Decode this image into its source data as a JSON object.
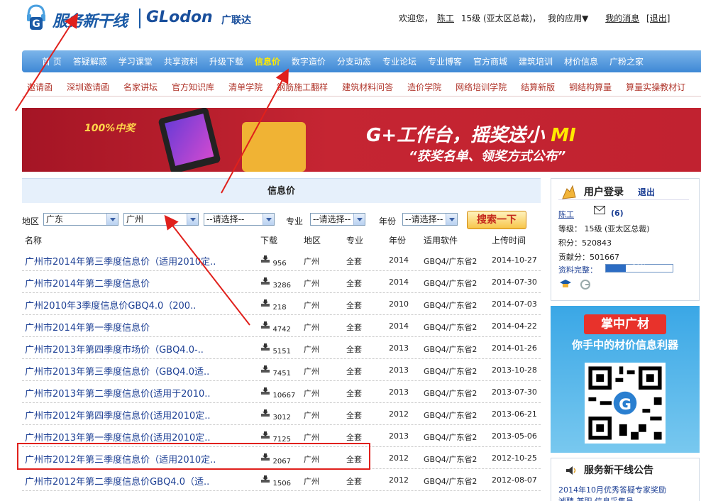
{
  "header": {
    "logo_text": "服务新干线",
    "brand": "GLodon",
    "brand_cn": "广联达",
    "welcome": "欢迎您，",
    "user": "陈工",
    "level": "15级 (亚太区总裁)，",
    "my_apps": "我的应用▼",
    "my_messages": "我的消息",
    "logout": "[退出]"
  },
  "main_nav": [
    "首 页",
    "答疑解惑",
    "学习课堂",
    "共享资料",
    "升级下载",
    "信息价",
    "数字造价",
    "分支动态",
    "专业论坛",
    "专业博客",
    "官方商城",
    "建筑培训",
    "材价信息",
    "广粉之家"
  ],
  "main_nav_active": "信息价",
  "sub_nav": [
    "邀请函",
    "深圳邀请函",
    "名家讲坛",
    "官方知识库",
    "清单学院",
    "钢筋施工翻样",
    "建筑材料问答",
    "造价学院",
    "网络培训学院",
    "结算新版",
    "钢结构算量",
    "算量实操教材订"
  ],
  "banner": {
    "badge": "100%中奖",
    "title_a": "G+工作台，摇奖送小 ",
    "title_b": "MI",
    "subtitle": "“获奖名单、领奖方式公布”"
  },
  "section_title": "信息价",
  "filters": {
    "region_label": "地区",
    "province": "广东",
    "city": "广州",
    "district": "--请选择--",
    "major_label": "专业",
    "major": "--请选择--",
    "year_label": "年份",
    "year": "--请选择--",
    "search_button": "搜索一下"
  },
  "table": {
    "headers": [
      "名称",
      "下载",
      "地区",
      "专业",
      "年份",
      "适用软件",
      "上传时间"
    ],
    "rows": [
      {
        "name": "广州市2014年第三季度信息价（适用2010定..",
        "downloads": "956",
        "area": "广州",
        "major": "全套",
        "year": "2014",
        "software": "GBQ4/广东省2",
        "date": "2014-10-27"
      },
      {
        "name": "广州市2014年第二季度信息价",
        "downloads": "3286",
        "area": "广州",
        "major": "全套",
        "year": "2014",
        "software": "GBQ4/广东省2",
        "date": "2014-07-30"
      },
      {
        "name": "广州2010年3季度信息价GBQ4.0（200..",
        "downloads": "218",
        "area": "广州",
        "major": "全套",
        "year": "2010",
        "software": "GBQ4/广东省2",
        "date": "2014-07-03"
      },
      {
        "name": "广州市2014年第一季度信息价",
        "downloads": "4742",
        "area": "广州",
        "major": "全套",
        "year": "2014",
        "software": "GBQ4/广东省2",
        "date": "2014-04-22"
      },
      {
        "name": "广州市2013年第四季度市场价（GBQ4.0-..",
        "downloads": "5151",
        "area": "广州",
        "major": "全套",
        "year": "2013",
        "software": "GBQ4/广东省2",
        "date": "2014-01-26"
      },
      {
        "name": "广州市2013年第三季度信息价（GBQ4.0适..",
        "downloads": "7451",
        "area": "广州",
        "major": "全套",
        "year": "2013",
        "software": "GBQ4/广东省2",
        "date": "2013-10-28"
      },
      {
        "name": "广州市2013年第二季度信息价(适用于2010..",
        "downloads": "10667",
        "area": "广州",
        "major": "全套",
        "year": "2013",
        "software": "GBQ4/广东省2",
        "date": "2013-07-30"
      },
      {
        "name": "广州市2012年第四季度信息价(适用2010定..",
        "downloads": "3012",
        "area": "广州",
        "major": "全套",
        "year": "2012",
        "software": "GBQ4/广东省2",
        "date": "2013-06-21"
      },
      {
        "name": "广州市2013年第一季度信息价(适用2010定..",
        "downloads": "7125",
        "area": "广州",
        "major": "全套",
        "year": "2013",
        "software": "GBQ4/广东省2",
        "date": "2013-05-06"
      },
      {
        "name": "广州市2012年第三季度信息价（适用2010定..",
        "downloads": "2067",
        "area": "广州",
        "major": "全套",
        "year": "2012",
        "software": "GBQ4/广东省2",
        "date": "2012-10-25"
      },
      {
        "name": "广州市2012年第二季度信息价GBQ4.0（适..",
        "downloads": "1506",
        "area": "广州",
        "major": "全套",
        "year": "2012",
        "software": "GBQ4/广东省2",
        "date": "2012-08-07"
      }
    ]
  },
  "login": {
    "title": "用户登录",
    "logout": "退出",
    "user": "陈工",
    "messages": "(6)",
    "level": "等级： 15级 (亚太区总裁)",
    "points": "积分：520843",
    "contribution": "贡献分：501667",
    "completeness_label": "资料完整：",
    "completeness": "30%",
    "completeness_value": 0.3
  },
  "promo": {
    "line1": "掌中广材",
    "line2": "你手中的材价信息利器"
  },
  "notice": {
    "title": "服务新干线公告",
    "item1": "2014年10月优秀答疑专家奖励",
    "item2": "诚聘 兼职 信息采集员"
  },
  "colors": {
    "nav_blue": "#3e88d5",
    "nav_active": "#ffea00",
    "subnav_text": "#b0352b",
    "link_blue": "#1c3f94",
    "banner_red": "#c52532",
    "highlight_red": "#e0201c"
  }
}
